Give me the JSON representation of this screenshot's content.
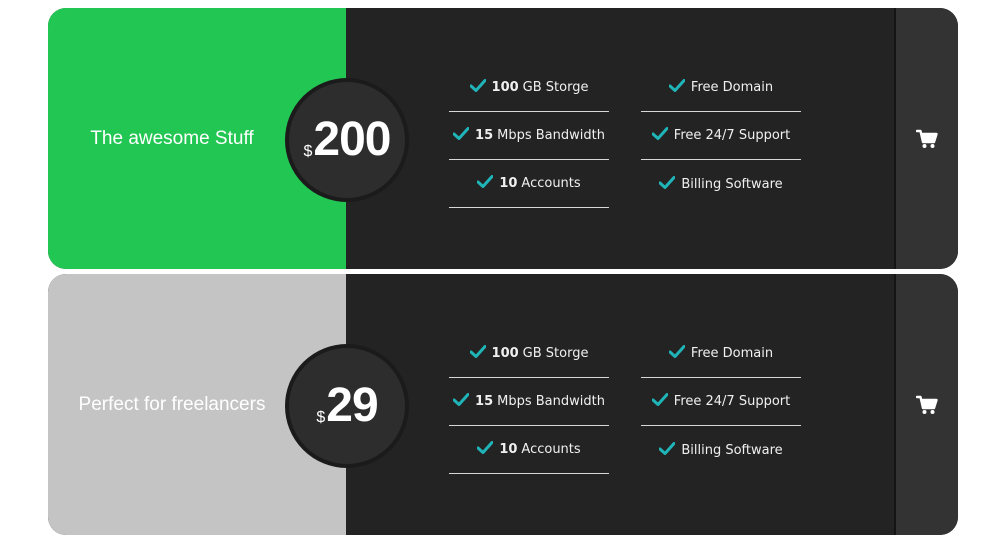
{
  "plans": [
    {
      "name": "The awesome Stuff",
      "currency": "$",
      "price": "200",
      "accent": "#22c753",
      "features": [
        {
          "bold": "100",
          "text": "GB Storge"
        },
        {
          "bold": "15",
          "text": "Mbps Bandwidth"
        },
        {
          "bold": "10",
          "text": "Accounts"
        },
        {
          "bold": "",
          "text": "Free Domain"
        },
        {
          "bold": "",
          "text": "Free 24/7 Support"
        },
        {
          "bold": "",
          "text": "Billing Software"
        }
      ],
      "cart_icon": "shopping-cart-icon"
    },
    {
      "name": "Perfect for freelancers",
      "currency": "$",
      "price": "29",
      "accent": "#c4c4c4",
      "features": [
        {
          "bold": "100",
          "text": "GB Storge"
        },
        {
          "bold": "15",
          "text": "Mbps Bandwidth"
        },
        {
          "bold": "10",
          "text": "Accounts"
        },
        {
          "bold": "",
          "text": "Free Domain"
        },
        {
          "bold": "",
          "text": "Free 24/7 Support"
        },
        {
          "bold": "",
          "text": "Billing Software"
        }
      ],
      "cart_icon": "shopping-cart-icon"
    }
  ],
  "colors": {
    "check": "#1fb5b8",
    "dark_panel": "#232323",
    "cart_panel": "#333333"
  }
}
